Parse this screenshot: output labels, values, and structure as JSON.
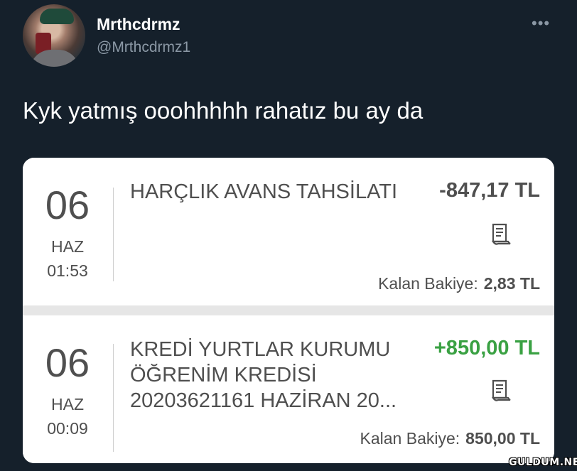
{
  "tweet": {
    "display_name": "Mrthcdrmz",
    "handle": "@Mrthcdrmz1",
    "more_label": "•••",
    "text": "Kyk yatmış ooohhhhh rahatız bu ay da"
  },
  "transactions": [
    {
      "day": "06",
      "month": "HAZ",
      "time": "01:53",
      "title_lines": [
        "HARÇLIK AVANS TAHSİLATI"
      ],
      "amount": "-847,17 TL",
      "balance_label": "Kalan Bakiye:",
      "balance_value": "2,83 TL"
    },
    {
      "day": "06",
      "month": "HAZ",
      "time": "00:09",
      "title_lines": [
        "KREDİ YURTLAR KURUMU",
        "ÖĞRENİM KREDİSİ",
        "20203621161 HAZİRAN 20..."
      ],
      "amount": "+850,00 TL",
      "balance_label": "Kalan Bakiye:",
      "balance_value": "850,00 TL"
    }
  ],
  "watermark": "GULDUM.NET",
  "colors": {
    "background": "#15202b",
    "negative_amount": "#4f4f4f",
    "positive_amount": "#3aa143"
  }
}
